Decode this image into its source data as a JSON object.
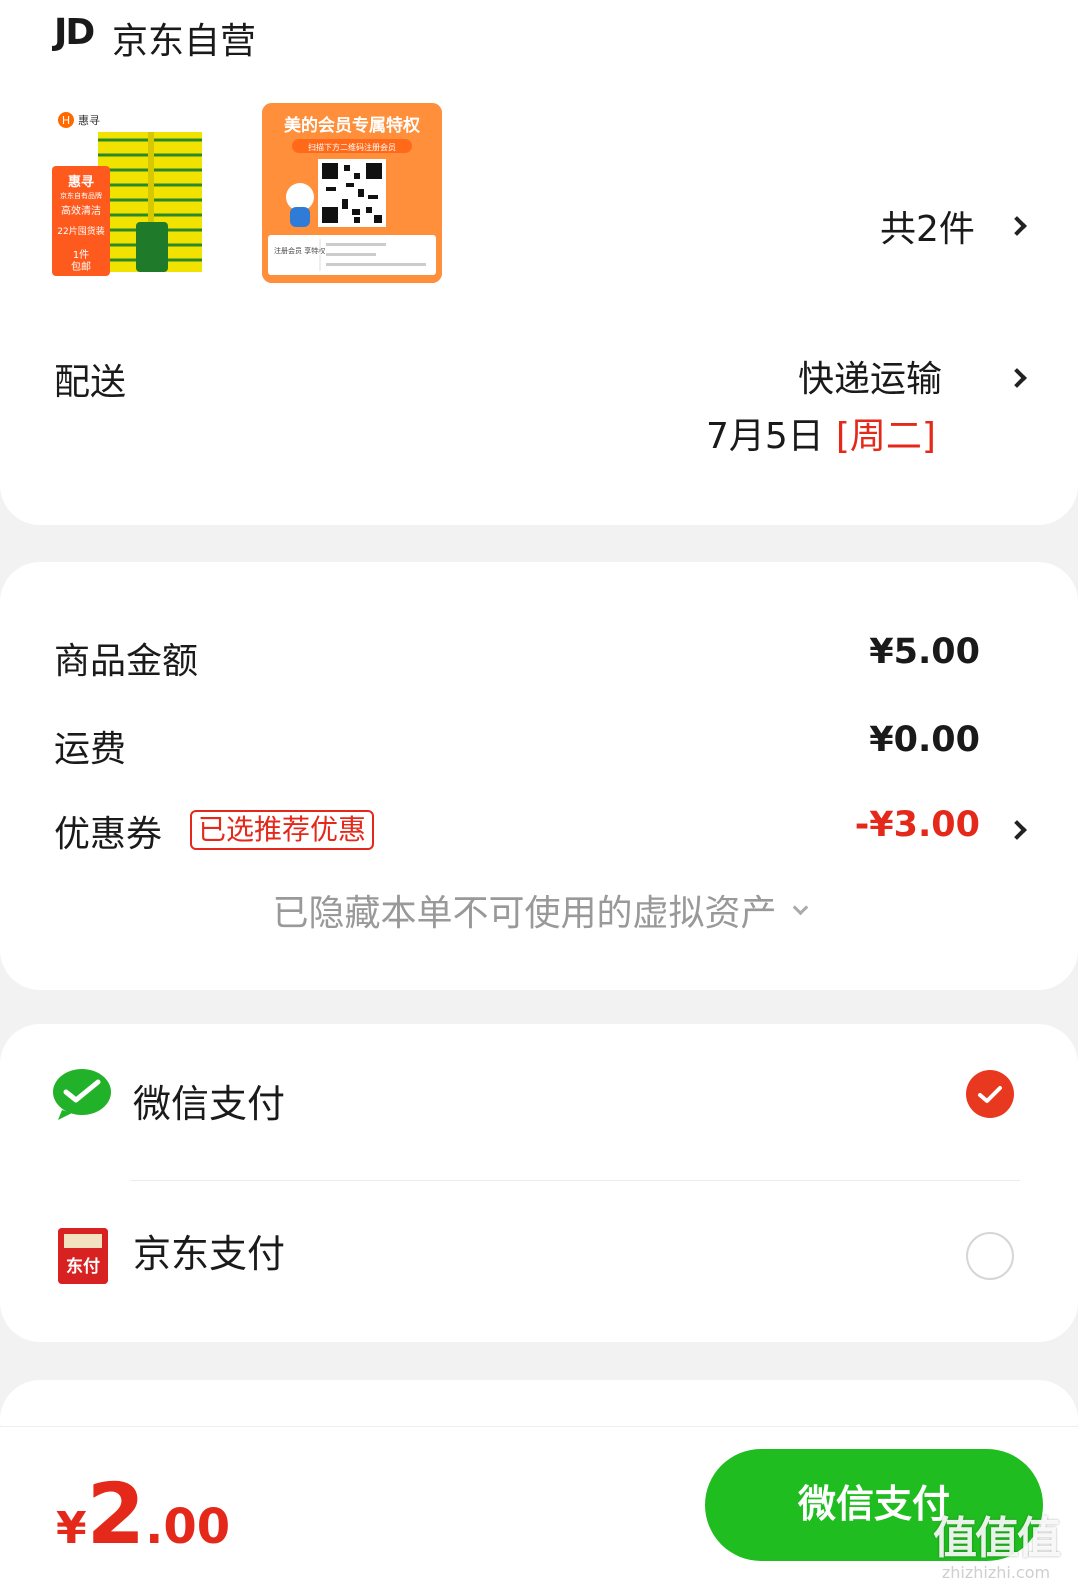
{
  "store": {
    "logo": "JD",
    "name": "京东自营"
  },
  "products": {
    "item1": {
      "brand": "惠寻",
      "tag1": "京东自有品牌",
      "tag2": "高效清洁",
      "tag3": "22片囤货装",
      "tag4a": "1件",
      "tag4b": "包邮"
    },
    "item2": {
      "title": "美的会员专属特权",
      "subtitle": "扫描下方二维码注册会员",
      "footer": "注册会员 享特权"
    },
    "count_label": "共2件"
  },
  "delivery": {
    "label": "配送",
    "method": "快递运输",
    "date": "7月5日",
    "weekday": "[周二]"
  },
  "amounts": {
    "goods_label": "商品金额",
    "goods_value": "¥5.00",
    "shipping_label": "运费",
    "shipping_value": "¥0.00",
    "coupon_label": "优惠券",
    "coupon_tag": "已选推荐优惠",
    "coupon_value": "-¥3.00",
    "hidden_assets": "已隐藏本单不可使用的虚拟资产"
  },
  "payment": {
    "wechat_label": "微信支付",
    "jdpay_label": "京东支付",
    "jdpay_icon_text": "东付",
    "selected": "wechat"
  },
  "footer": {
    "currency": "¥",
    "total_int": "2",
    "total_dec": ".00",
    "pay_button": "微信支付",
    "watermark_main": "值值值",
    "watermark_sub": "zhizhizhi.com"
  },
  "colors": {
    "accent_red": "#e4291b",
    "wechat_green": "#1fbd1f"
  }
}
